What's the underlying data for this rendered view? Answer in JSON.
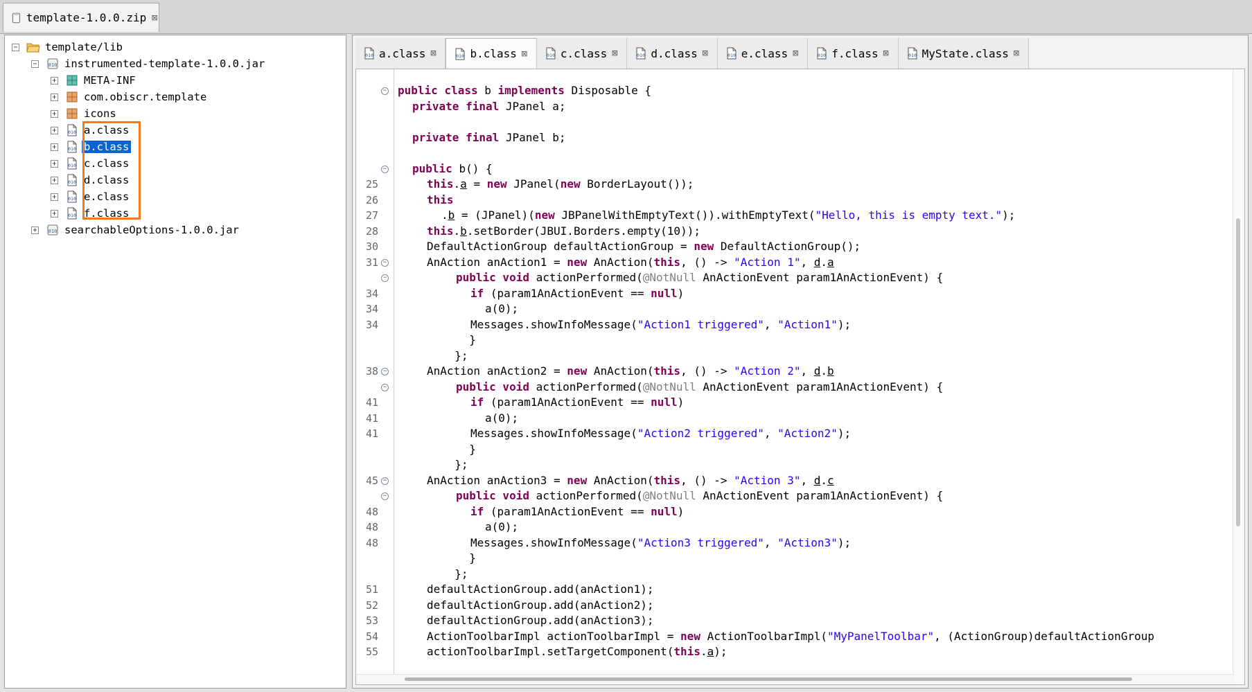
{
  "window_tab": {
    "title": "template-1.0.0.zip"
  },
  "tree": {
    "items": [
      {
        "label": "template/lib",
        "icon": "folder-open-icon",
        "depth": 0,
        "toggle": "−"
      },
      {
        "label": "instrumented-template-1.0.0.jar",
        "icon": "jar-icon",
        "depth": 1,
        "toggle": "−"
      },
      {
        "label": "META-INF",
        "icon": "package-teal-icon",
        "depth": 2,
        "toggle": "+"
      },
      {
        "label": "com.obiscr.template",
        "icon": "package-icon",
        "depth": 2,
        "toggle": "+"
      },
      {
        "label": "icons",
        "icon": "package-icon",
        "depth": 2,
        "toggle": "+"
      },
      {
        "label": "a.class",
        "icon": "class-file-icon",
        "depth": 2,
        "toggle": "+"
      },
      {
        "label": "b.class",
        "icon": "class-file-icon",
        "depth": 2,
        "toggle": "+",
        "selected": true
      },
      {
        "label": "c.class",
        "icon": "class-file-icon",
        "depth": 2,
        "toggle": "+"
      },
      {
        "label": "d.class",
        "icon": "class-file-icon",
        "depth": 2,
        "toggle": "+"
      },
      {
        "label": "e.class",
        "icon": "class-file-icon",
        "depth": 2,
        "toggle": "+"
      },
      {
        "label": "f.class",
        "icon": "class-file-icon",
        "depth": 2,
        "toggle": "+"
      },
      {
        "label": "searchableOptions-1.0.0.jar",
        "icon": "jar-icon",
        "depth": 1,
        "toggle": "+"
      }
    ]
  },
  "editor_tabs": [
    {
      "label": "a.class"
    },
    {
      "label": "b.class",
      "active": true
    },
    {
      "label": "c.class"
    },
    {
      "label": "d.class"
    },
    {
      "label": "e.class"
    },
    {
      "label": "f.class"
    },
    {
      "label": "MyState.class"
    }
  ],
  "code": {
    "lines": [
      {
        "num": "",
        "fold": true,
        "indent": 0,
        "parts": [
          [
            "kw",
            "public class "
          ],
          [
            "",
            "b "
          ],
          [
            "kw",
            "implements "
          ],
          [
            "",
            "Disposable {"
          ]
        ]
      },
      {
        "num": "",
        "indent": 1,
        "parts": [
          [
            "kw",
            "private final "
          ],
          [
            "",
            "JPanel a;"
          ]
        ]
      },
      {
        "num": "",
        "indent": 0,
        "parts": []
      },
      {
        "num": "",
        "indent": 1,
        "parts": [
          [
            "kw",
            "private final "
          ],
          [
            "",
            "JPanel b;"
          ]
        ]
      },
      {
        "num": "",
        "indent": 0,
        "parts": []
      },
      {
        "num": "",
        "fold": true,
        "indent": 1,
        "parts": [
          [
            "kw",
            "public "
          ],
          [
            "",
            "b() {"
          ]
        ]
      },
      {
        "num": "25",
        "indent": 2,
        "parts": [
          [
            "kw",
            "this"
          ],
          [
            "",
            "."
          ],
          [
            "u",
            "a"
          ],
          [
            "",
            " = "
          ],
          [
            "kw",
            "new "
          ],
          [
            "",
            "JPanel("
          ],
          [
            "kw",
            "new "
          ],
          [
            "",
            "BorderLayout());"
          ]
        ]
      },
      {
        "num": "26",
        "indent": 2,
        "parts": [
          [
            "kw",
            "this"
          ]
        ]
      },
      {
        "num": "27",
        "indent": 3,
        "parts": [
          [
            "",
            "."
          ],
          [
            "u",
            "b"
          ],
          [
            "",
            " = (JPanel)("
          ],
          [
            "kw",
            "new "
          ],
          [
            "",
            "JBPanelWithEmptyText()).withEmptyText("
          ],
          [
            "str",
            "\"Hello, this is empty text.\""
          ],
          [
            "",
            ");"
          ]
        ]
      },
      {
        "num": "28",
        "indent": 2,
        "parts": [
          [
            "kw",
            "this"
          ],
          [
            "",
            "."
          ],
          [
            "u",
            "b"
          ],
          [
            "",
            ".setBorder(JBUI.Borders.empty(10));"
          ]
        ]
      },
      {
        "num": "30",
        "indent": 2,
        "parts": [
          [
            "",
            "DefaultActionGroup defaultActionGroup = "
          ],
          [
            "kw",
            "new "
          ],
          [
            "",
            "DefaultActionGroup();"
          ]
        ]
      },
      {
        "num": "31",
        "fold": true,
        "indent": 2,
        "parts": [
          [
            "",
            "AnAction anAction1 = "
          ],
          [
            "kw",
            "new "
          ],
          [
            "",
            "AnAction("
          ],
          [
            "kw",
            "this"
          ],
          [
            "",
            ", () -> "
          ],
          [
            "str",
            "\"Action 1\""
          ],
          [
            "",
            ", "
          ],
          [
            "u",
            "d"
          ],
          [
            "",
            "."
          ],
          [
            "u",
            "a"
          ],
          [
            ") {"
          ]
        ]
      },
      {
        "num": "",
        "fold": true,
        "indent": 4,
        "parts": [
          [
            "kw",
            "public void "
          ],
          [
            "",
            "actionPerformed("
          ],
          [
            "ann",
            "@NotNull "
          ],
          [
            "",
            "AnActionEvent param1AnActionEvent) {"
          ]
        ]
      },
      {
        "num": "34",
        "indent": 5,
        "parts": [
          [
            "kw",
            "if "
          ],
          [
            "",
            "(param1AnActionEvent == "
          ],
          [
            "kw",
            "null"
          ],
          [
            "",
            ")"
          ]
        ]
      },
      {
        "num": "34",
        "indent": 6,
        "parts": [
          [
            "",
            "a(0);"
          ]
        ]
      },
      {
        "num": "34",
        "indent": 5,
        "parts": [
          [
            "",
            "Messages.showInfoMessage("
          ],
          [
            "str",
            "\"Action1 triggered\""
          ],
          [
            "",
            ", "
          ],
          [
            "str",
            "\"Action1\""
          ],
          [
            "",
            ");"
          ]
        ]
      },
      {
        "num": "",
        "indent": 4,
        "parts": [
          [
            "",
            "  }"
          ]
        ]
      },
      {
        "num": "",
        "indent": 3,
        "parts": [
          [
            "",
            "  };"
          ]
        ]
      },
      {
        "num": "38",
        "fold": true,
        "indent": 2,
        "parts": [
          [
            "",
            "AnAction anAction2 = "
          ],
          [
            "kw",
            "new "
          ],
          [
            "",
            "AnAction("
          ],
          [
            "kw",
            "this"
          ],
          [
            "",
            ", () -> "
          ],
          [
            "str",
            "\"Action 2\""
          ],
          [
            "",
            ", "
          ],
          [
            "u",
            "d"
          ],
          [
            "",
            "."
          ],
          [
            "u",
            "b"
          ],
          [
            ") {"
          ]
        ]
      },
      {
        "num": "",
        "fold": true,
        "indent": 4,
        "parts": [
          [
            "kw",
            "public void "
          ],
          [
            "",
            "actionPerformed("
          ],
          [
            "ann",
            "@NotNull "
          ],
          [
            "",
            "AnActionEvent param1AnActionEvent) {"
          ]
        ]
      },
      {
        "num": "41",
        "indent": 5,
        "parts": [
          [
            "kw",
            "if "
          ],
          [
            "",
            "(param1AnActionEvent == "
          ],
          [
            "kw",
            "null"
          ],
          [
            "",
            ")"
          ]
        ]
      },
      {
        "num": "41",
        "indent": 6,
        "parts": [
          [
            "",
            "a(0);"
          ]
        ]
      },
      {
        "num": "41",
        "indent": 5,
        "parts": [
          [
            "",
            "Messages.showInfoMessage("
          ],
          [
            "str",
            "\"Action2 triggered\""
          ],
          [
            "",
            ", "
          ],
          [
            "str",
            "\"Action2\""
          ],
          [
            "",
            ");"
          ]
        ]
      },
      {
        "num": "",
        "indent": 4,
        "parts": [
          [
            "",
            "  }"
          ]
        ]
      },
      {
        "num": "",
        "indent": 3,
        "parts": [
          [
            "",
            "  };"
          ]
        ]
      },
      {
        "num": "45",
        "fold": true,
        "indent": 2,
        "parts": [
          [
            "",
            "AnAction anAction3 = "
          ],
          [
            "kw",
            "new "
          ],
          [
            "",
            "AnAction("
          ],
          [
            "kw",
            "this"
          ],
          [
            "",
            ", () -> "
          ],
          [
            "str",
            "\"Action 3\""
          ],
          [
            "",
            ", "
          ],
          [
            "u",
            "d"
          ],
          [
            "",
            "."
          ],
          [
            "u",
            "c"
          ],
          [
            ") {"
          ]
        ]
      },
      {
        "num": "",
        "fold": true,
        "indent": 4,
        "parts": [
          [
            "kw",
            "public void "
          ],
          [
            "",
            "actionPerformed("
          ],
          [
            "ann",
            "@NotNull "
          ],
          [
            "",
            "AnActionEvent param1AnActionEvent) {"
          ]
        ]
      },
      {
        "num": "48",
        "indent": 5,
        "parts": [
          [
            "kw",
            "if "
          ],
          [
            "",
            "(param1AnActionEvent == "
          ],
          [
            "kw",
            "null"
          ],
          [
            "",
            ")"
          ]
        ]
      },
      {
        "num": "48",
        "indent": 6,
        "parts": [
          [
            "",
            "a(0);"
          ]
        ]
      },
      {
        "num": "48",
        "indent": 5,
        "parts": [
          [
            "",
            "Messages.showInfoMessage("
          ],
          [
            "str",
            "\"Action3 triggered\""
          ],
          [
            "",
            ", "
          ],
          [
            "str",
            "\"Action3\""
          ],
          [
            "",
            ");"
          ]
        ]
      },
      {
        "num": "",
        "indent": 4,
        "parts": [
          [
            "",
            "  }"
          ]
        ]
      },
      {
        "num": "",
        "indent": 3,
        "parts": [
          [
            "",
            "  };"
          ]
        ]
      },
      {
        "num": "51",
        "indent": 2,
        "parts": [
          [
            "",
            "defaultActionGroup.add(anAction1);"
          ]
        ]
      },
      {
        "num": "52",
        "indent": 2,
        "parts": [
          [
            "",
            "defaultActionGroup.add(anAction2);"
          ]
        ]
      },
      {
        "num": "53",
        "indent": 2,
        "parts": [
          [
            "",
            "defaultActionGroup.add(anAction3);"
          ]
        ]
      },
      {
        "num": "54",
        "indent": 2,
        "parts": [
          [
            "",
            "ActionToolbarImpl actionToolbarImpl = "
          ],
          [
            "kw",
            "new "
          ],
          [
            "",
            "ActionToolbarImpl("
          ],
          [
            "str",
            "\"MyPanelToolbar\""
          ],
          [
            "",
            ", (ActionGroup)defaultActionGroup"
          ]
        ]
      },
      {
        "num": "55",
        "indent": 2,
        "parts": [
          [
            "",
            "actionToolbarImpl.setTargetComponent("
          ],
          [
            "kw",
            "this"
          ],
          [
            "",
            "."
          ],
          [
            "u",
            "a"
          ],
          [
            "",
            ");"
          ]
        ]
      }
    ]
  }
}
